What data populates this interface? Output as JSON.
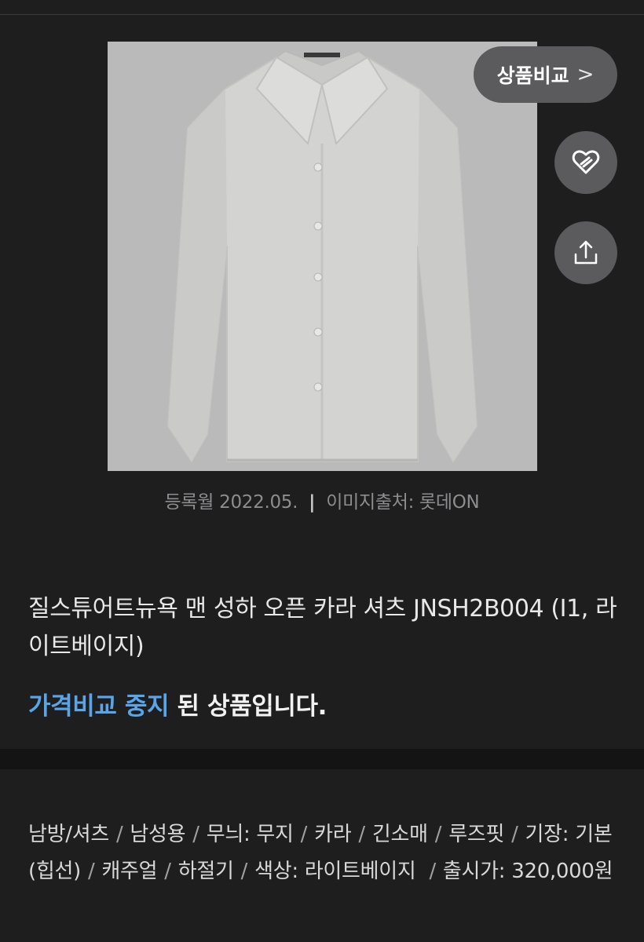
{
  "product_image": {
    "description_icon": "shirt-image"
  },
  "actions": {
    "compare_label": "상품비교",
    "compare_chevron": ">",
    "wish_icon": "heart-link-icon",
    "share_icon": "share-icon"
  },
  "image_meta": {
    "registered": "등록월 2022.05.",
    "separator": "|",
    "source": "이미지출처: 롯데ON"
  },
  "product": {
    "title": "질스튜어트뉴욕 맨 성하 오픈 카라 셔츠 JNSH2B004 (I1, 라이트베이지)",
    "status_highlight": "가격비교 중지",
    "status_rest": " 된 상품입니다."
  },
  "specs": [
    "남방/셔츠",
    "남성용",
    "무늬: 무지",
    "카라",
    "긴소매",
    "루즈핏",
    "기장: 기본(힙선)",
    "캐주얼",
    "하절기",
    "색상: 라이트베이지 ",
    "출시가: 320,000원"
  ],
  "colors": {
    "background": "#1e1e1f",
    "highlight": "#5aa5e8",
    "button": "#5b5b5d"
  }
}
